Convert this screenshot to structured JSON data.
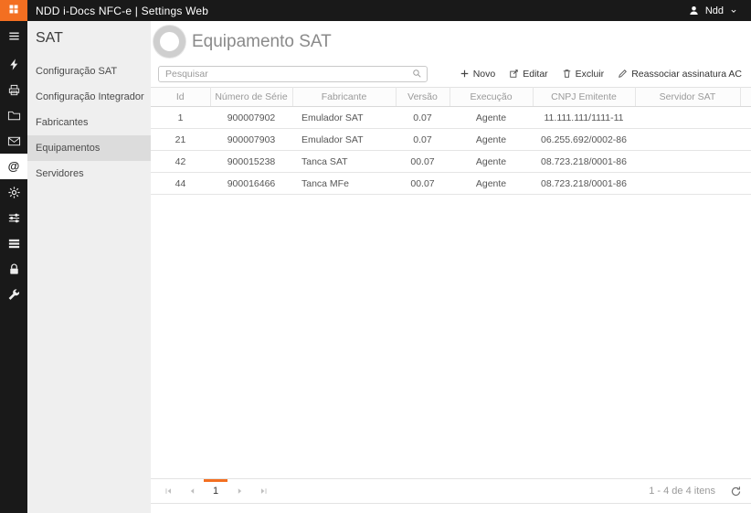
{
  "colors": {
    "accent": "#f36f21",
    "topbar_bg": "#191919"
  },
  "topbar": {
    "title": "NDD i-Docs NFC-e | Settings Web",
    "user_name": "Ndd"
  },
  "rail": {
    "items": [
      {
        "icon": "menu",
        "active": false
      },
      {
        "icon": "flash",
        "active": false
      },
      {
        "icon": "printer",
        "active": false
      },
      {
        "icon": "folder",
        "active": false
      },
      {
        "icon": "envelope",
        "active": false
      },
      {
        "icon": "at",
        "active": true
      },
      {
        "icon": "gear",
        "active": false
      },
      {
        "icon": "sliders",
        "active": false
      },
      {
        "icon": "list",
        "active": false
      },
      {
        "icon": "lock",
        "active": false
      },
      {
        "icon": "wrench",
        "active": false
      }
    ]
  },
  "sidebar": {
    "title": "SAT",
    "items": [
      {
        "label": "Configuração SAT",
        "active": false
      },
      {
        "label": "Configuração Integrador",
        "active": false
      },
      {
        "label": "Fabricantes",
        "active": false
      },
      {
        "label": "Equipamentos",
        "active": true
      },
      {
        "label": "Servidores",
        "active": false
      }
    ]
  },
  "main": {
    "title": "Equipamento SAT",
    "search_placeholder": "Pesquisar",
    "toolbar": [
      {
        "label": "Novo",
        "icon": "plus"
      },
      {
        "label": "Editar",
        "icon": "edit"
      },
      {
        "label": "Excluir",
        "icon": "trash"
      },
      {
        "label": "Reassociar assinatura AC",
        "icon": "pencil"
      }
    ],
    "table": {
      "columns": [
        "Id",
        "Número de Série",
        "Fabricante",
        "Versão",
        "Execução",
        "CNPJ Emitente",
        "Servidor SAT"
      ],
      "rows": [
        [
          "1",
          "900007902",
          "Emulador SAT",
          "0.07",
          "Agente",
          "11.111.111/1111-11",
          ""
        ],
        [
          "21",
          "900007903",
          "Emulador SAT",
          "0.07",
          "Agente",
          "06.255.692/0002-86",
          ""
        ],
        [
          "42",
          "900015238",
          "Tanca SAT",
          "00.07",
          "Agente",
          "08.723.218/0001-86",
          ""
        ],
        [
          "44",
          "900016466",
          "Tanca MFe",
          "00.07",
          "Agente",
          "08.723.218/0001-86",
          ""
        ]
      ]
    },
    "pager": {
      "page": "1",
      "summary": "1 - 4 de 4 itens"
    }
  }
}
